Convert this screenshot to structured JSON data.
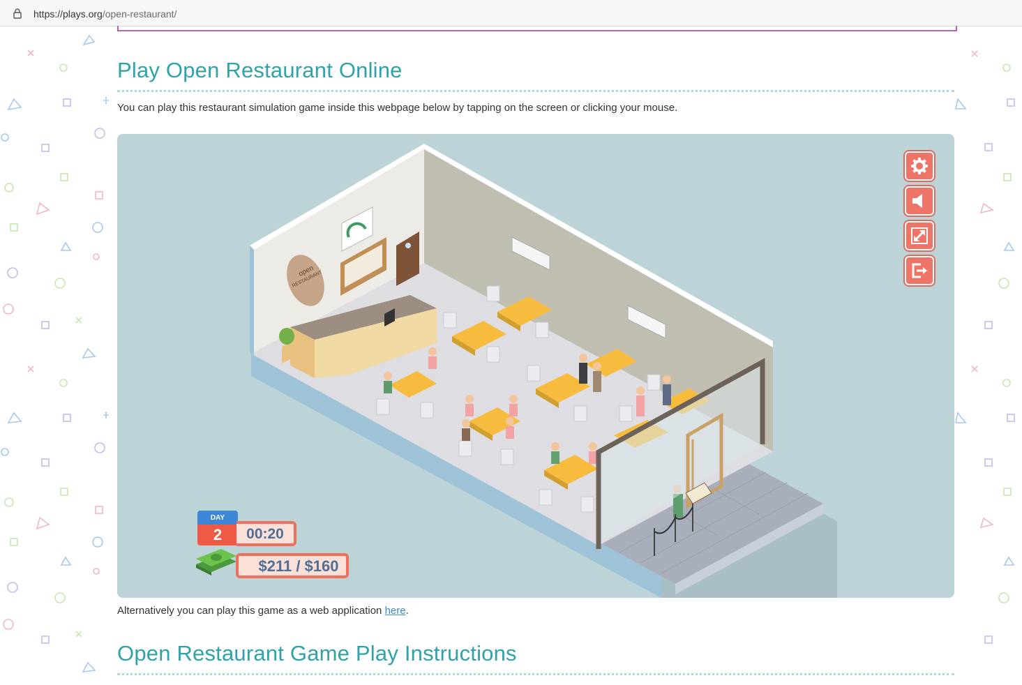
{
  "browser": {
    "url_host": "https://plays.org",
    "url_path": "/open-restaurant/"
  },
  "section1": {
    "title": "Play Open Restaurant Online",
    "intro": "You can play this restaurant simulation game inside this webpage below by tapping on the screen or clicking your mouse."
  },
  "game": {
    "logo_line1": "open",
    "logo_line2": "RESTAURANT",
    "controls": [
      "settings-icon",
      "sound-icon",
      "fullscreen-icon",
      "exit-icon"
    ],
    "day_label": "DAY",
    "day": "2",
    "timer": "00:20",
    "money": "$211 / $160"
  },
  "alt_text": {
    "prefix": "Alternatively you can play this game as a web application ",
    "link": "here",
    "suffix": "."
  },
  "section2": {
    "title": "Open Restaurant Game Play Instructions"
  },
  "colors": {
    "heading": "#2fa3a8",
    "control": "#ee7467",
    "game_bg": "#bcd4d8"
  }
}
